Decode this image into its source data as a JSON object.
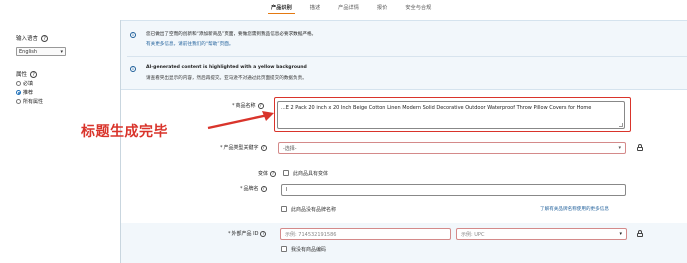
{
  "tabs": [
    {
      "label": "产品识别",
      "active": true
    },
    {
      "label": "描述",
      "active": false
    },
    {
      "label": "产品详情",
      "active": false
    },
    {
      "label": "报价",
      "active": false
    },
    {
      "label": "安全与合规",
      "active": false
    }
  ],
  "left_panel": {
    "input_language_label": "输入语言",
    "language_value": "English",
    "attributes_label": "属性",
    "attribute_options": [
      {
        "label": "必填",
        "selected": false
      },
      {
        "label": "推荐",
        "selected": true
      },
      {
        "label": "所有属性",
        "selected": false
      }
    ]
  },
  "notice": {
    "line1": "您已做出了空而的创新和“添加新商品”页面，要做您需到我品信息必要求数据严格。",
    "line2": "有关更多信息，请前往我们的“帮助”页面。",
    "ai_title": "AI-generated content is highlighted with a yellow background",
    "ai_line": "请查看突出显示的内容，然后再提交。亚马逊不对通过此页面提交的数据负责。"
  },
  "form": {
    "product_name_label": "商品名称",
    "product_name_value": "...E 2 Pack 20 inch x 20 Inch Beige Cotton Linen Modern Solid Decorative Outdoor Waterproof Throw Pillow Covers for Home",
    "annotation": "标题生成完毕",
    "category_keyword_label": "产品类型关键字",
    "category_placeholder": "-选择-",
    "variation_label": "变体",
    "variation_checkbox": "此商品具有变体",
    "brand_label": "品牌名",
    "brand_value": "l",
    "no_brand_checkbox": "此商品没有品牌名称",
    "brand_help_link": "了解有关品牌名称使用的更多信息",
    "external_id_label": "外部产品 ID",
    "external_id_placeholder": "示例: 714532191586",
    "id_type_placeholder": "示例: UPC",
    "no_barcode_checkbox": "我没有商品编码"
  },
  "colors": {
    "accent": "#e47911",
    "highlight_red": "#d9342b",
    "link_blue": "#1f5f9a",
    "notice_bg": "#f2f7fb"
  }
}
